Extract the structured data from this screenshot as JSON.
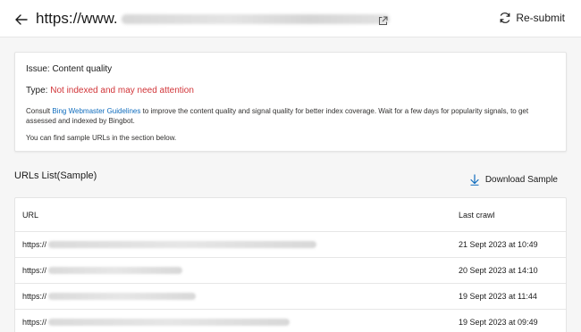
{
  "header": {
    "url_prefix": "https://www.",
    "resubmit_label": "Re-submit"
  },
  "issue": {
    "issue_text": "Issue: Content quality",
    "type_label": "Type: ",
    "type_value": "Not indexed and may need attention",
    "type_color": "#d13438",
    "desc_prefix": "Consult ",
    "desc_link": "Bing Webmaster Guidelines",
    "desc_suffix": " to improve the content quality and signal quality for better index coverage. Wait for a few days for popularity signals, to get assessed and indexed by Bingbot.",
    "note": "You can find sample URLs in the section below."
  },
  "list": {
    "title": "URLs List(Sample)",
    "download_label": "Download Sample",
    "columns": [
      "URL",
      "Last crawl"
    ],
    "rows": [
      {
        "url_prefix": "https://",
        "last_crawl": "21 Sept 2023 at 10:49"
      },
      {
        "url_prefix": "https://",
        "last_crawl": "20 Sept 2023 at 14:10"
      },
      {
        "url_prefix": "https://",
        "last_crawl": "19 Sept 2023 at 11:44"
      },
      {
        "url_prefix": "https://",
        "last_crawl": "19 Sept 2023 at 09:49"
      }
    ]
  },
  "icons": {
    "back": "arrow-left-icon",
    "external": "open-external-icon",
    "resubmit": "refresh-icon",
    "download": "download-arrow-icon"
  },
  "colors": {
    "link": "#0f6cbd",
    "accent": "#0f6cbd"
  }
}
